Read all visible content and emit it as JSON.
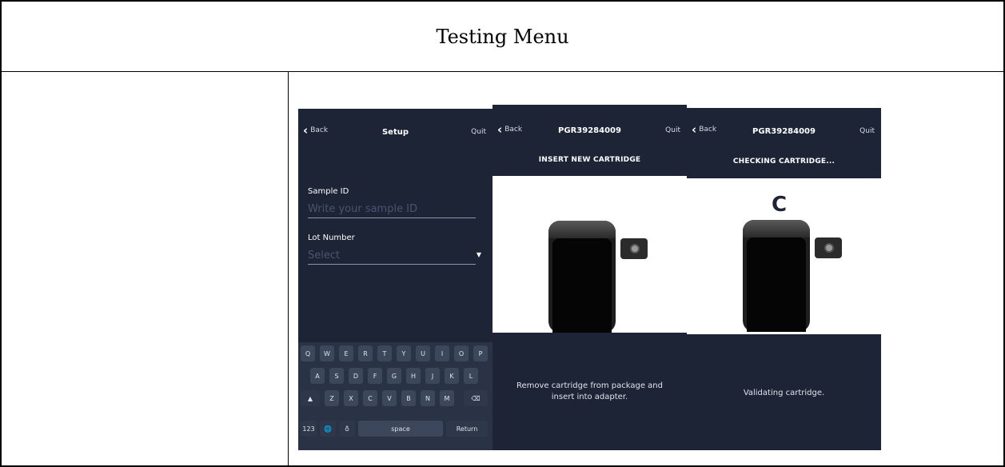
{
  "document": {
    "title": "Testing Menu"
  },
  "screens": {
    "setup": {
      "back_label": "Back",
      "title": "Setup",
      "quit_label": "Quit",
      "sample_id_label": "Sample ID",
      "sample_id_placeholder": "Write your sample ID",
      "lot_number_label": "Lot Number",
      "lot_number_placeholder": "Select",
      "keyboard": {
        "row1": [
          "Q",
          "W",
          "E",
          "R",
          "T",
          "Y",
          "U",
          "I",
          "O",
          "P"
        ],
        "row2": [
          "A",
          "S",
          "D",
          "F",
          "G",
          "H",
          "J",
          "K",
          "L"
        ],
        "row3": [
          "Z",
          "X",
          "C",
          "V",
          "B",
          "N",
          "M"
        ],
        "numbers_key": "123",
        "space_key": "space",
        "return_key": "Return"
      }
    },
    "insert": {
      "back_label": "Back",
      "title": "PGR39284009",
      "quit_label": "Quit",
      "subheading": "INSERT NEW CARTRIDGE",
      "message_line1": "Remove cartridge from package and",
      "message_line2": "insert into adapter."
    },
    "checking": {
      "back_label": "Back",
      "title": "PGR39284009",
      "quit_label": "Quit",
      "subheading": "CHECKING CARTRIDGE...",
      "message": "Validating cartridge."
    }
  },
  "colors": {
    "screen_bg": "#1c2436",
    "keyboard_bg": "#2a3346",
    "key_bg": "#3d475c"
  }
}
